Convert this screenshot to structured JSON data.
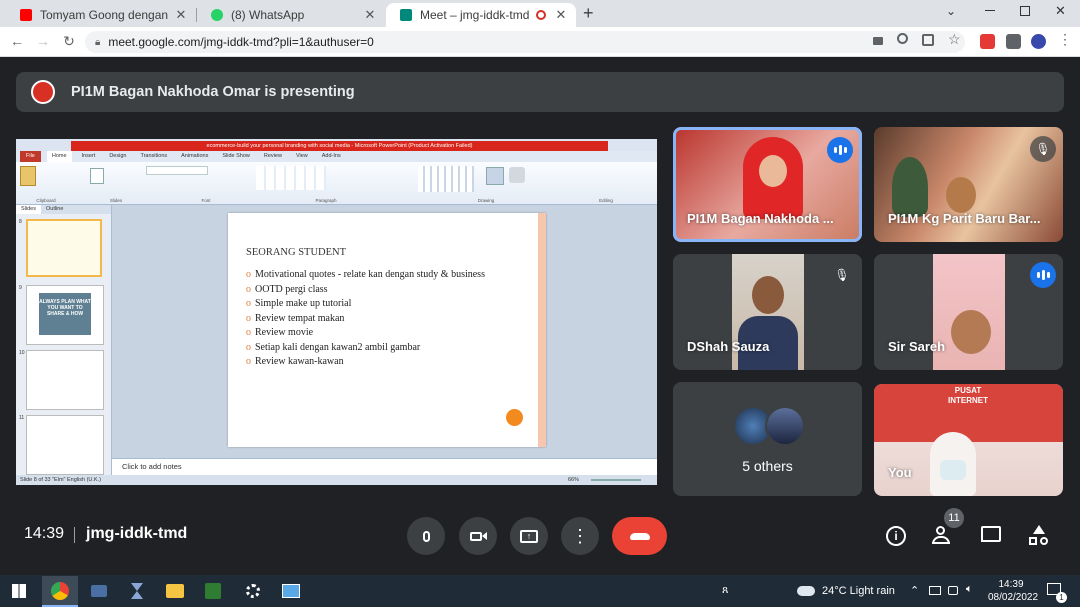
{
  "browser": {
    "tabs": [
      {
        "title": "Tomyam Goong dengan Homem",
        "fav_color": "#ff0000"
      },
      {
        "title": "(8) WhatsApp",
        "fav_color": "#25d366"
      },
      {
        "title": "Meet – jmg-iddk-tmd",
        "fav_color": "#00897b"
      }
    ],
    "url": "meet.google.com/jmg-iddk-tmd?pli=1&authuser=0",
    "new_tab": "+"
  },
  "meet": {
    "banner_text": "PI1M Bagan Nakhoda Omar is presenting",
    "meeting_time": "14:39",
    "meeting_code": "jmg-iddk-tmd",
    "participants_count": "11",
    "tiles": [
      {
        "name": "PI1M Bagan Nakhoda ...",
        "status": "speaking"
      },
      {
        "name": "PI1M Kg Parit Baru Bar...",
        "status": "muted"
      },
      {
        "name": "DShah Sauza",
        "status": "muted"
      },
      {
        "name": "Sir Sareh",
        "status": "speaking"
      },
      {
        "name": "5 others",
        "status": "group"
      },
      {
        "name": "You",
        "status": "self"
      }
    ],
    "you_tile_sign": "PUSAT INTERNET"
  },
  "ppt": {
    "window_title": "ecommerce-build your personal branding with social media - Microsoft PowerPoint (Product Activation Failed)",
    "ribbon_tabs": [
      "File",
      "Home",
      "Insert",
      "Design",
      "Transitions",
      "Animations",
      "Slide Show",
      "Review",
      "View",
      "Add-Ins"
    ],
    "ribbon_groups": [
      "Clipboard",
      "Slides",
      "Font",
      "Paragraph",
      "Drawing",
      "Editing"
    ],
    "panel_tabs": [
      "Slides",
      "Outline"
    ],
    "slide_numbers": [
      "8",
      "9",
      "10",
      "11"
    ],
    "slide_title": "SEORANG STUDENT",
    "bullets": [
      "Motivational quotes - relate kan dengan study & business",
      "OOTD pergi class",
      "Simple make up tutorial",
      "Review tempat makan",
      "Review movie",
      "Setiap kali dengan kawan2 ambil gambar",
      "Review kawan-kawan"
    ],
    "notes_placeholder": "Click to add notes",
    "status_left": "Slide 8 of 33   \"Elm\"   English (U.K.)",
    "zoom": "66%",
    "thumb9_text": "ALWAYS PLAN WHAT YOU WANT TO SHARE & HOW"
  },
  "taskbar": {
    "weather": "24°C  Light rain",
    "time": "14:39",
    "date": "08/02/2022",
    "notif_count": "1"
  },
  "colors": {
    "meet_bg": "#202124",
    "tile_bg": "#3c4043",
    "end_call": "#ea4335",
    "speaking": "#1a73e8",
    "ppt_title_bar": "#d9261c"
  }
}
